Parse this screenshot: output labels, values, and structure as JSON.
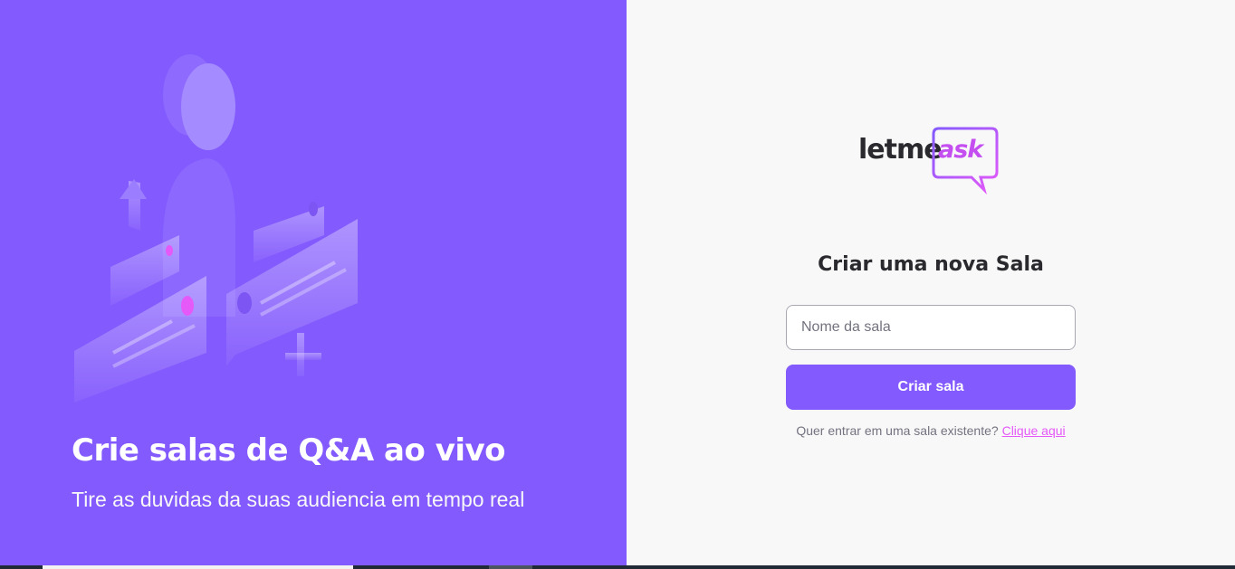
{
  "aside": {
    "illustration_icon": "q-and-a-illustration",
    "title": "Crie salas de Q&A ao vivo",
    "subtitle": "Tire as duvidas da suas audiencia em tempo real"
  },
  "logo": {
    "part1": "letme",
    "part2": "ask"
  },
  "form": {
    "title": "Criar uma nova Sala",
    "input_placeholder": "Nome da sala",
    "input_value": "",
    "submit_label": "Criar sala",
    "join_prompt": "Quer entrar em uma sala existente?",
    "join_link": "Clique aqui"
  },
  "colors": {
    "primary": "#835afd",
    "accent": "#e559f9",
    "background": "#f8f8f8",
    "text": "#29292e"
  }
}
